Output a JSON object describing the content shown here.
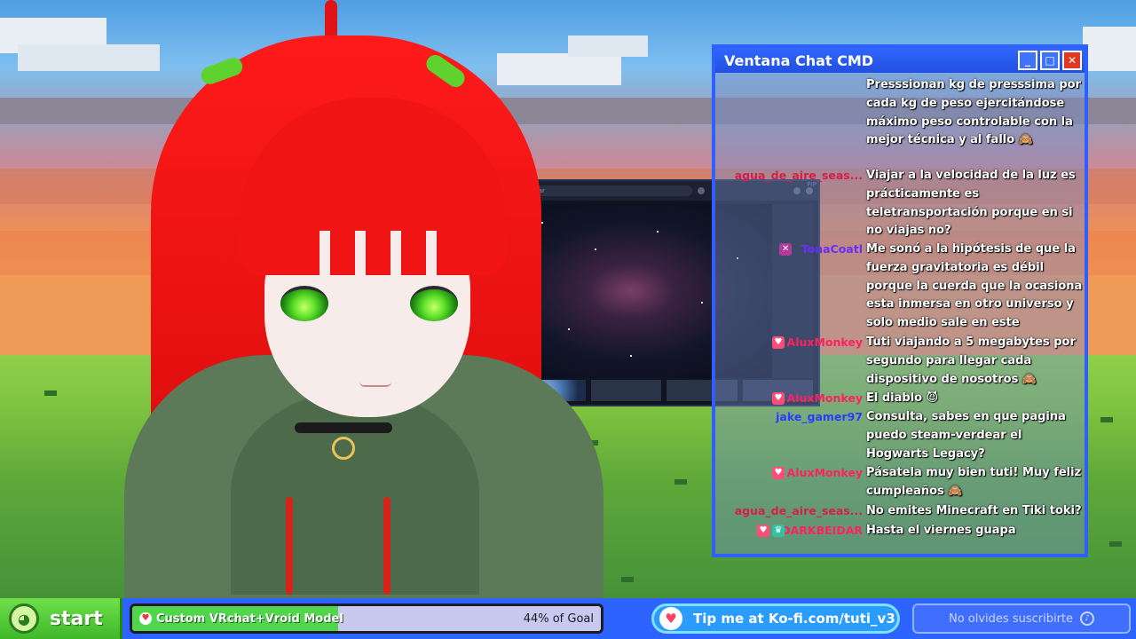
{
  "chat_window": {
    "title": "Ventana Chat CMD",
    "buttons": {
      "minimize": "_",
      "maximize": "□",
      "close": "✕"
    },
    "messages": [
      {
        "user": "",
        "color": "#e0294a",
        "text": "Presssionan kg de presssima por cada kg de peso ejercitándose máximo peso controlable con la mejor técnica y al fallo 🙈",
        "badges": []
      },
      {
        "user": "agua_de_aire_seas...",
        "color": "#d3204a",
        "text": "Viajar a la velocidad de la luz es prácticamente es teletransportación porque en si no viajas no?",
        "badges": []
      },
      {
        "user": "TonaCoatl",
        "color": "#6a2cff",
        "text": "Me sonó a la hipótesis de que la fuerza gravitatoria es débil porque la cuerda que la ocasiona esta inmersa en otro universo y solo medio sale en este",
        "badges": [
          "x"
        ]
      },
      {
        "user": "AluxMonkey",
        "color": "#ff2060",
        "text": "Tuti viajando a 5 megabytes por segundo para llegar cada dispositivo de nosotros 🙈",
        "badges": [
          "heart"
        ]
      },
      {
        "user": "AluxMonkey",
        "color": "#ff2060",
        "text": "El diablo 😈",
        "badges": [
          "heart"
        ]
      },
      {
        "user": "jake_gamer97",
        "color": "#2a3cff",
        "text": "Consulta, sabes en que pagina puedo steam-verdear el Hogwarts Legacy?",
        "badges": []
      },
      {
        "user": "AluxMonkey",
        "color": "#ff2060",
        "text": "Pásatela muy bien tuti! Muy feliz cumpleaños 🙈",
        "badges": [
          "heart"
        ]
      },
      {
        "user": "agua_de_aire_seas...",
        "color": "#d3204a",
        "text": "No emites Minecraft en Tiki toki?",
        "badges": []
      },
      {
        "user": "DARKBEIDAR",
        "color": "#ff2060",
        "text": "Hasta el viernes guapa",
        "badges": [
          "heart",
          "crown"
        ]
      }
    ]
  },
  "screen": {
    "search_placeholder": "Buscar",
    "pip_label": "PIP"
  },
  "taskbar": {
    "start_label": "start",
    "goal_label": "Custom VRchat+Vroid Model",
    "goal_percent_text": "44% of Goal",
    "goal_progress": 0.44,
    "kofi_text": "Tip me at Ko-fi.com/tuti_v3",
    "subscribe_text": "No olvides suscribirte"
  },
  "colors": {
    "accent": "#2f5fff",
    "start_green": "#3fb82a",
    "close_red": "#e5381e"
  },
  "icons": {
    "start": "frog-logo-icon",
    "goal": "heart-icon",
    "kofi": "kofi-cup-icon",
    "subscribe": "bell-icon"
  }
}
